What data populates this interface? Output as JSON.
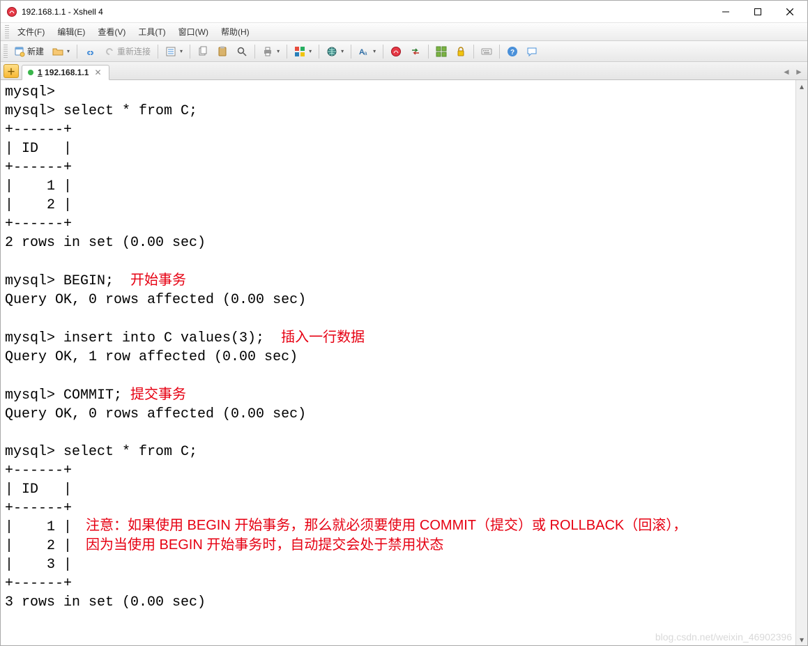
{
  "titlebar": {
    "title": "192.168.1.1 - Xshell 4"
  },
  "menubar": {
    "items": [
      "文件(F)",
      "编辑(E)",
      "查看(V)",
      "工具(T)",
      "窗口(W)",
      "帮助(H)"
    ]
  },
  "toolbar": {
    "new_label": "新建",
    "reconnect_label": "重新连接"
  },
  "tab": {
    "index": "1",
    "label": "192.168.1.1"
  },
  "terminal": {
    "lines": [
      "mysql>",
      "mysql> select * from C;",
      "+------+",
      "| ID   |",
      "+------+",
      "|    1 |",
      "|    2 |",
      "+------+",
      "2 rows in set (0.00 sec)",
      "",
      "mysql> BEGIN;  ",
      "Query OK, 0 rows affected (0.00 sec)",
      "",
      "mysql> insert into C values(3);  ",
      "Query OK, 1 row affected (0.00 sec)",
      "",
      "mysql> COMMIT; ",
      "Query OK, 0 rows affected (0.00 sec)",
      "",
      "mysql> select * from C;",
      "+------+",
      "| ID   |",
      "+------+",
      "|    1 |",
      "|    2 |",
      "|    3 |",
      "+------+",
      "3 rows in set (0.00 sec)"
    ],
    "annotations": {
      "begin": "开始事务",
      "insert": "插入一行数据",
      "commit": "提交事务",
      "note_line1": "注意：如果使用 BEGIN 开始事务，那么就必须要使用 COMMIT（提交）或 ROLLBACK（回滚），",
      "note_line2": "因为当使用 BEGIN 开始事务时，自动提交会处于禁用状态"
    }
  },
  "watermark": "blog.csdn.net/weixin_46902396"
}
